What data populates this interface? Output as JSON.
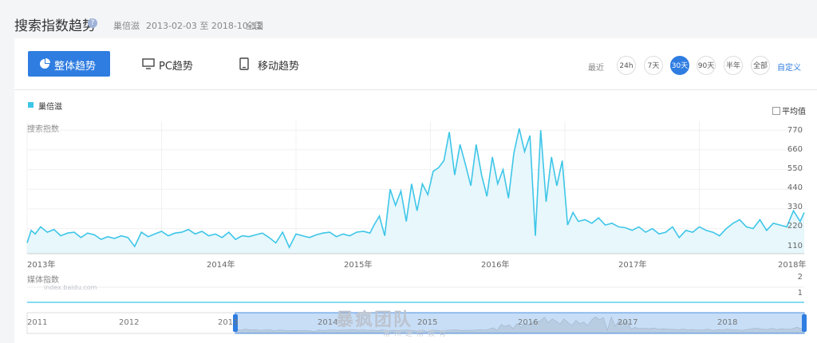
{
  "header": {
    "title": "搜索指数趋势",
    "keyword": "巢倍滋",
    "date_range": "2013-02-03 至 2018-10-12",
    "region": "全国"
  },
  "tabs": {
    "overall": "整体趋势",
    "pc": "PC趋势",
    "mobile": "移动趋势"
  },
  "range": {
    "label": "最近",
    "options": [
      "24h",
      "7天",
      "30天",
      "90天",
      "半年",
      "全部"
    ],
    "selected": "30天",
    "custom": "自定义"
  },
  "legend": {
    "series_name": "巢倍滋",
    "average_label": "平均值"
  },
  "colors": {
    "accent": "#2f7de1",
    "series": "#3ec6e8",
    "fill": "#e7f7fc"
  },
  "chart_data": [
    {
      "type": "area",
      "subtitle": "搜索指数",
      "source_watermark": "index.baidu.com",
      "x_tick_labels": [
        "2013年",
        "2014年",
        "2015年",
        "2016年",
        "2017年",
        "2018年"
      ],
      "y_ticks": [
        110,
        220,
        330,
        440,
        550,
        660,
        770
      ],
      "ylim": [
        80,
        820
      ],
      "series": [
        {
          "name": "巢倍滋",
          "x": [
            2013.0,
            2013.03,
            2013.06,
            2013.1,
            2013.15,
            2013.2,
            2013.25,
            2013.3,
            2013.35,
            2013.4,
            2013.45,
            2013.5,
            2013.55,
            2013.6,
            2013.65,
            2013.7,
            2013.75,
            2013.8,
            2013.85,
            2013.9,
            2013.95,
            2014.0,
            2014.05,
            2014.1,
            2014.15,
            2014.2,
            2014.25,
            2014.3,
            2014.35,
            2014.4,
            2014.45,
            2014.5,
            2014.55,
            2014.6,
            2014.65,
            2014.7,
            2014.75,
            2014.8,
            2014.85,
            2014.9,
            2014.95,
            2015.0,
            2015.05,
            2015.1,
            2015.15,
            2015.2,
            2015.25,
            2015.3,
            2015.35,
            2015.4,
            2015.45,
            2015.5,
            2015.55,
            2015.58,
            2015.62,
            2015.66,
            2015.7,
            2015.74,
            2015.78,
            2015.82,
            2015.86,
            2015.9,
            2015.94,
            2015.98,
            2016.02,
            2016.06,
            2016.1,
            2016.14,
            2016.18,
            2016.22,
            2016.26,
            2016.3,
            2016.34,
            2016.38,
            2016.42,
            2016.46,
            2016.5,
            2016.54,
            2016.58,
            2016.62,
            2016.66,
            2016.7,
            2016.74,
            2016.78,
            2016.82,
            2016.86,
            2016.9,
            2016.94,
            2016.98,
            2017.02,
            2017.06,
            2017.1,
            2017.15,
            2017.2,
            2017.25,
            2017.3,
            2017.35,
            2017.4,
            2017.45,
            2017.5,
            2017.55,
            2017.6,
            2017.65,
            2017.7,
            2017.75,
            2017.8,
            2017.85,
            2017.9,
            2017.95,
            2018.0,
            2018.05,
            2018.1,
            2018.15,
            2018.2,
            2018.25,
            2018.3,
            2018.35,
            2018.4,
            2018.45,
            2018.5,
            2018.55,
            2018.6,
            2018.65,
            2018.7,
            2018.75,
            2018.78
          ],
          "values": [
            140,
            210,
            190,
            230,
            200,
            215,
            180,
            195,
            200,
            170,
            195,
            185,
            160,
            175,
            165,
            180,
            170,
            120,
            200,
            175,
            190,
            205,
            180,
            195,
            200,
            215,
            190,
            205,
            180,
            190,
            170,
            200,
            160,
            180,
            175,
            185,
            195,
            170,
            140,
            200,
            115,
            190,
            180,
            170,
            185,
            195,
            200,
            175,
            190,
            180,
            200,
            205,
            195,
            240,
            290,
            180,
            440,
            350,
            430,
            260,
            470,
            320,
            470,
            410,
            540,
            560,
            600,
            760,
            520,
            690,
            580,
            460,
            690,
            520,
            400,
            620,
            470,
            550,
            390,
            640,
            780,
            650,
            740,
            180,
            770,
            370,
            620,
            460,
            600,
            240,
            310,
            260,
            270,
            250,
            280,
            240,
            250,
            230,
            225,
            210,
            230,
            200,
            220,
            190,
            200,
            230,
            170,
            210,
            200,
            230,
            210,
            200,
            180,
            220,
            250,
            270,
            230,
            220,
            270,
            210,
            250,
            240,
            230,
            320,
            260,
            310
          ]
        }
      ]
    },
    {
      "type": "line",
      "subtitle": "媒体指数",
      "y_ticks": [
        1,
        2
      ],
      "ylim": [
        0,
        2
      ],
      "series": [
        {
          "name": "巢倍滋",
          "x": [
            2013.0,
            2018.78
          ],
          "values": [
            0,
            0
          ]
        }
      ]
    },
    {
      "type": "area",
      "role": "range-selector",
      "x_tick_labels": [
        "2011",
        "2012",
        "2013",
        "2014",
        "2015",
        "2016",
        "2017",
        "2018"
      ],
      "selected_range": [
        "2013",
        "2018"
      ]
    }
  ],
  "watermark": {
    "brand": "暴疯团队",
    "slogan": "常州进帮教育"
  }
}
